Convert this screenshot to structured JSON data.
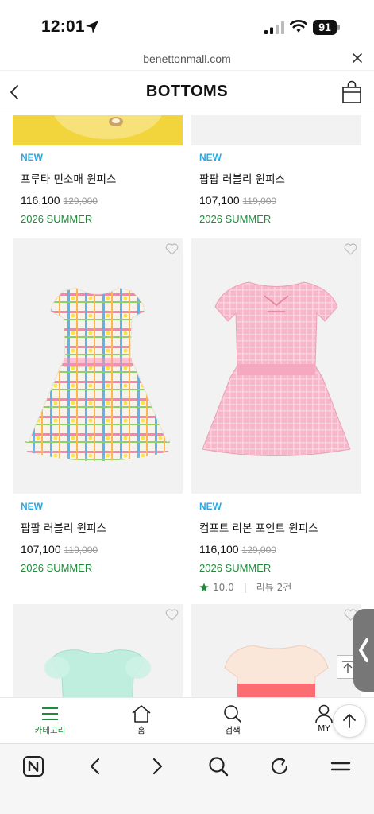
{
  "status": {
    "time": "12:01",
    "battery": "91"
  },
  "url": {
    "domain": "benettonmall.com"
  },
  "header": {
    "title": "BOTTOMS"
  },
  "products": [
    {
      "badge": "NEW",
      "name": "프루타 민소매 원피스",
      "price": "116,100",
      "original_price": "129,000",
      "season": "2026 SUMMER"
    },
    {
      "badge": "NEW",
      "name": "팝팝 러블리 원피스",
      "price": "107,100",
      "original_price": "119,000",
      "season": "2026 SUMMER"
    },
    {
      "badge": "NEW",
      "name": "팝팝 러블리 원피스",
      "price": "107,100",
      "original_price": "119,000",
      "season": "2026 SUMMER"
    },
    {
      "badge": "NEW",
      "name": "컴포트 리본 포인트 원피스",
      "price": "116,100",
      "original_price": "129,000",
      "season": "2026 SUMMER",
      "rating": "10.0",
      "reviews": "리뷰 2건"
    }
  ],
  "app_nav": [
    {
      "label": "카테고리",
      "icon": "menu-icon",
      "active": true
    },
    {
      "label": "홈",
      "icon": "home-icon"
    },
    {
      "label": "검색",
      "icon": "search-icon"
    },
    {
      "label": "MY",
      "icon": "user-icon"
    }
  ],
  "browser_toolbar": [
    "naver-icon",
    "back-icon",
    "forward-icon",
    "search-icon",
    "refresh-icon",
    "menu-icon"
  ],
  "colors": {
    "new_badge": "#2aa8e0",
    "season": "#1f8a3a",
    "accent_green": "#1f8a3a"
  }
}
